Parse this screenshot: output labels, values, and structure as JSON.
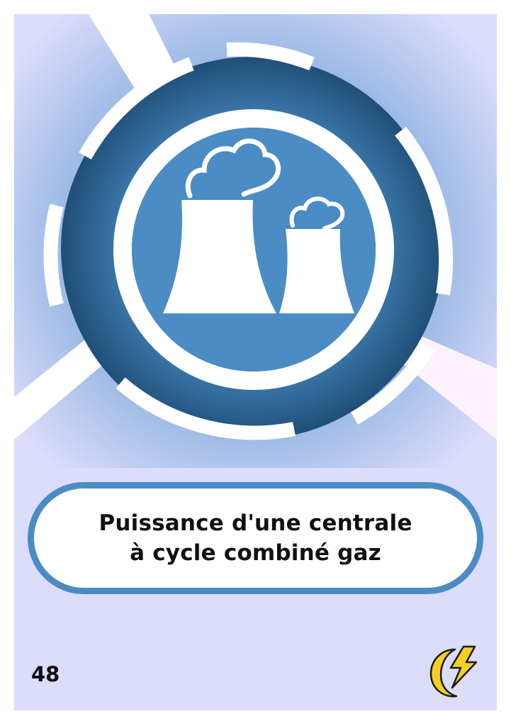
{
  "card": {
    "title_lines": [
      "Puissance d'une centrale",
      "à cycle combiné gaz"
    ],
    "number": "48"
  },
  "icons": {
    "illustration": "gas-power-plant-icon",
    "logo": "lightning-moon-icon"
  },
  "colors": {
    "card_background": "#dcdcfb",
    "ring_blue": "#4a8cc3",
    "ring_dark": "#2e6a9a",
    "title_border": "#4a8cc3",
    "logo_yellow": "#f5d020"
  }
}
